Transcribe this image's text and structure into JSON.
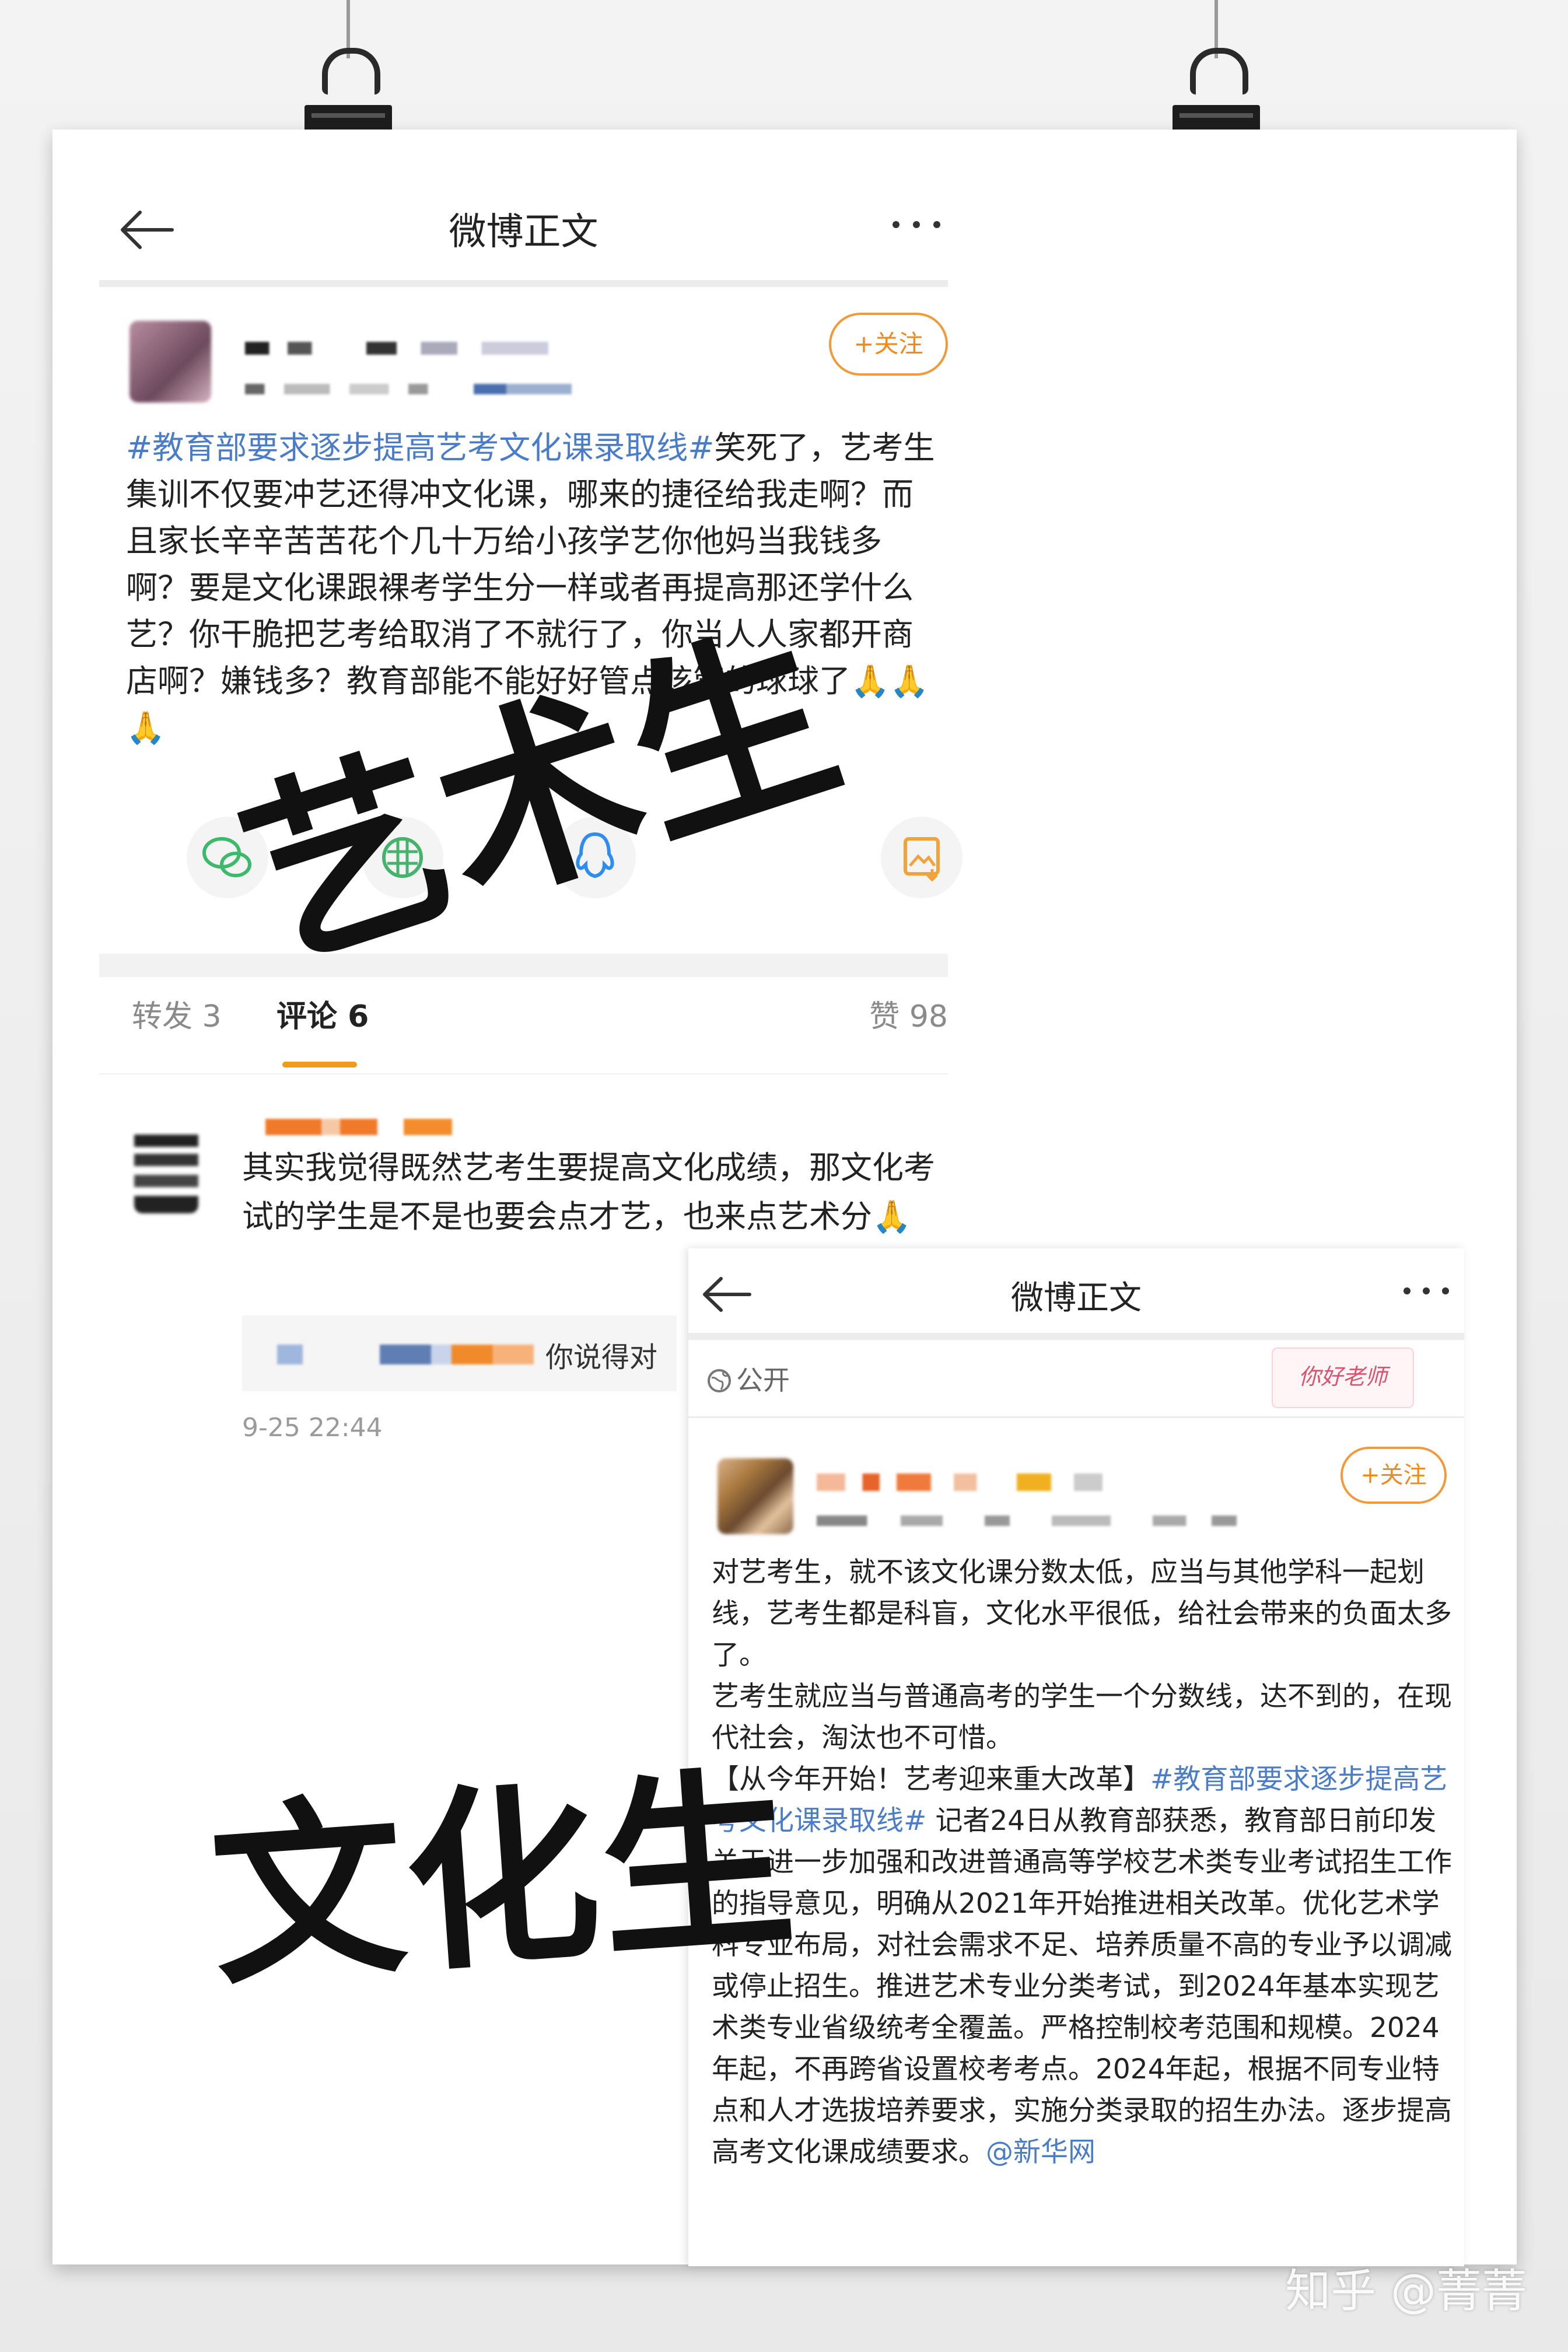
{
  "card1": {
    "header": {
      "title": "微博正文"
    },
    "follow_label": "+关注",
    "post": {
      "hashtag": "#教育部要求逐步提高艺考文化课录取线#",
      "body": "笑死了，艺考生集训不仅要冲艺还得冲文化课，哪来的捷径给我走啊？而且家长辛辛苦苦花个几十万给小孩学艺你他妈当我钱多啊？要是文化课跟裸考学生分一样或者再提高那还学什么艺？你干脆把艺考给取消了不就行了，你当人人家都开商店啊？嫌钱多？教育部能不能好好管点该管的球球了🙏🙏🙏"
    },
    "tabs": {
      "repost": "转发 3",
      "comment": "评论 6",
      "like": "赞 98"
    },
    "comment": {
      "text": "其实我觉得既然艺考生要提高文化成绩，那文化考试的学生是不是也要会点才艺，也来点艺术分🙏",
      "reply": "你说得对",
      "time": "9-25 22:44"
    }
  },
  "card2": {
    "header": {
      "title": "微博正文"
    },
    "visibility": "公开",
    "sticker": "你好老师",
    "follow_label": "+关注",
    "paragraph1": "对艺考生，就不该文化课分数太低，应当与其他学科一起划线，艺考生都是科盲，文化水平很低，给社会带来的负面太多了。",
    "paragraph2": "艺考生就应当与普通高考的学生一个分数线，达不到的，在现代社会，淘汰也不可惜。",
    "news_prefix": "【从今年开始！艺考迎来重大改革】",
    "news_hashtag": "#教育部要求逐步提高艺考文化课录取线#",
    "news_body": " 记者24日从教育部获悉，教育部日前印发关于进一步加强和改进普通高等学校艺术类专业考试招生工作的指导意见，明确从2021年开始推进相关改革。优化艺术学科专业布局，对社会需求不足、培养质量不高的专业予以调减或停止招生。推进艺术专业分类考试，到2024年基本实现艺术类专业省级统考全覆盖。严格控制校考范围和规模。2024年起，不再跨省设置校考考点。2024年起，根据不同专业特点和人才选拔培养要求，实施分类录取的招生办法。逐步提高高考文化课成绩要求。",
    "news_source": "@新华网"
  },
  "overlays": {
    "art": "艺术生",
    "culture": "文化生"
  },
  "watermark": "知乎 @菁菁",
  "colors": {
    "link": "#4a7cc8",
    "follow": "#f08a1a",
    "tab_active": "#f09a1e"
  }
}
